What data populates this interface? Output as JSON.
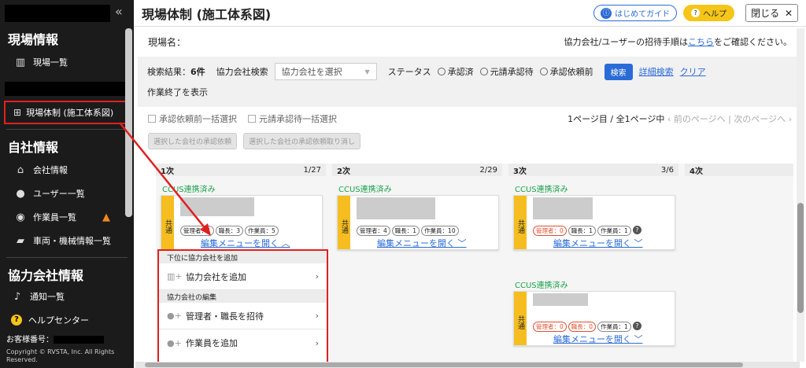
{
  "sidebar": {
    "collapse_icon": "«",
    "section_site": "現場情報",
    "item_site_list": "現場一覧",
    "item_active": "現場体制 (施工体系図)",
    "section_company": "自社情報",
    "item_company_info": "会社情報",
    "item_user_list": "ユーザー一覧",
    "item_worker_list": "作業員一覧",
    "item_vehicle": "車両・機械情報一覧",
    "section_partner": "協力会社情報",
    "item_notice": "通知一覧",
    "item_help_center": "ヘルプセンター",
    "customer_label": "お客様番号：",
    "copyright": "Copyright © RVSTA, Inc. All Rights Reserved."
  },
  "header": {
    "title": "現場体制 (施工体系図)",
    "guide_label": "はじめてガイド",
    "help_label": "ヘルプ",
    "close_label": "閉じる"
  },
  "site": {
    "site_name_label": "現場名：",
    "invite_text_pre": "協力会社/ユーザーの招待手順は",
    "invite_link": "こちら",
    "invite_text_post": "をご確認ください。"
  },
  "filters": {
    "result_label": "検索結果：",
    "result_count": "6件",
    "partner_search_label": "協力会社検索",
    "partner_select_placeholder": "協力会社を選択",
    "status_label": "ステータス",
    "status_options": [
      "承認済",
      "元請承認待",
      "承認依頼前"
    ],
    "search_button": "検索",
    "detail_search": "詳細検索",
    "clear": "クリア",
    "show_finished": "作業終了を表示"
  },
  "bulk": {
    "select_before_request": "承認依頼前一括選択",
    "select_prime_waiting": "元請承認待一括選択",
    "pager_text": "1ページ目 / 全1ページ中",
    "prev_page": "前のページへ",
    "next_page": "次のページへ",
    "request_button": "選択した会社の承認依頼",
    "cancel_request_button": "選択した会社の承認依頼取り消し"
  },
  "columns": [
    {
      "label": "1次",
      "count": "1/27"
    },
    {
      "label": "2次",
      "count": "2/29"
    },
    {
      "label": "3次",
      "count": "3/6"
    },
    {
      "label": "4次",
      "count": ""
    }
  ],
  "cards": {
    "ccus_label": "CCUS連携済み",
    "shared_tag": "共通",
    "edit_open": "編集メニューを開く",
    "card1_pills": [
      "管理者：1",
      "職長：3",
      "作業員：5"
    ],
    "card2_pills": [
      "管理者：4",
      "職長：1",
      "作業員：10"
    ],
    "card3_pills": [
      "管理者：0",
      "職長：1",
      "作業員：1"
    ],
    "card4_pills": [
      "管理者：0",
      "職長：0",
      "作業員：1"
    ]
  },
  "edit_menu": {
    "header_lower": "下位に協力会社を追加",
    "add_partner": "協力会社を追加",
    "header_edit": "協力会社の編集",
    "invite_manager": "管理者・職長を招待",
    "add_worker": "作業員を追加"
  },
  "colors": {
    "accent_blue": "#2a6bd8",
    "ccus_green": "#1aa34a",
    "highlight_red": "#e02020",
    "tag_yellow": "#f5bd1f"
  }
}
